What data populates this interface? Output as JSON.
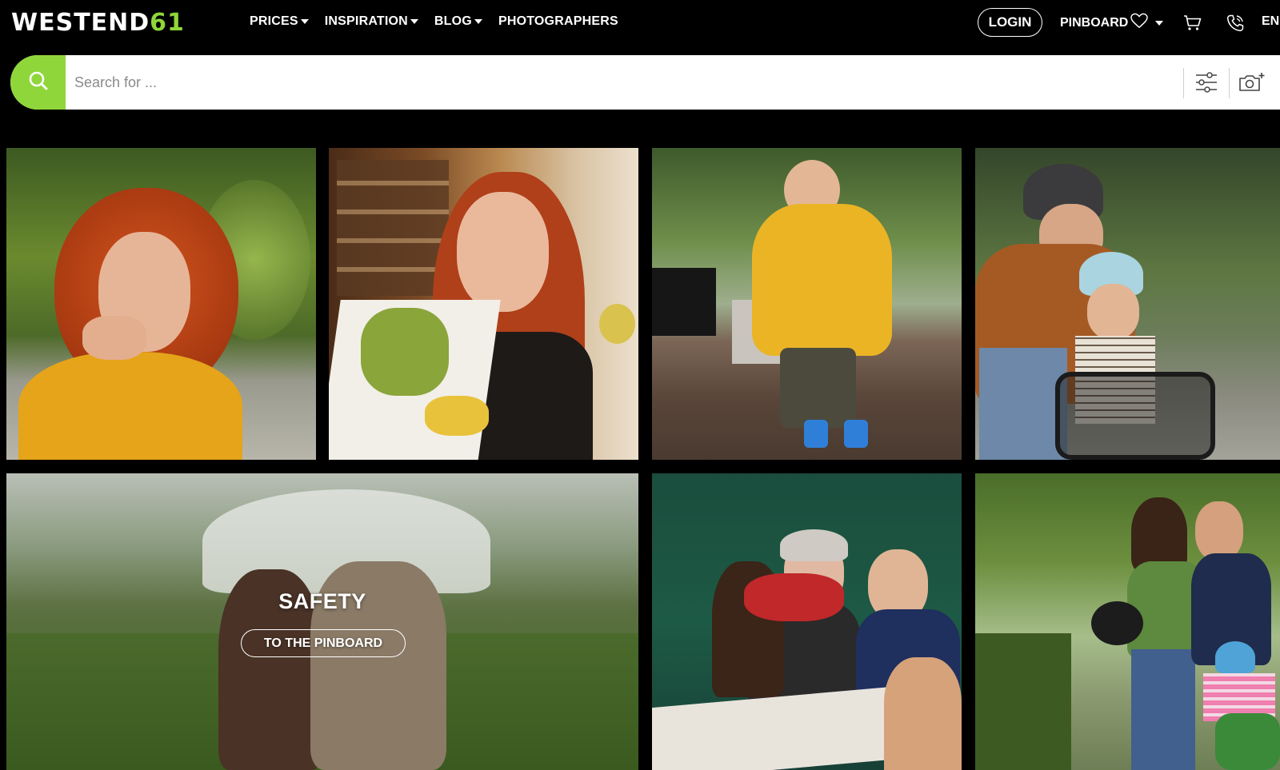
{
  "header": {
    "logo_main": "WESTEND",
    "logo_accent": "61",
    "nav": [
      {
        "label": "PRICES",
        "dropdown": true
      },
      {
        "label": "INSPIRATION",
        "dropdown": true
      },
      {
        "label": "BLOG",
        "dropdown": true
      },
      {
        "label": "PHOTOGRAPHERS",
        "dropdown": false
      }
    ],
    "login_label": "LOGIN",
    "pinboard_label": "PINBOARD",
    "language": "EN",
    "icons": [
      "heart-icon",
      "cart-icon",
      "phone-icon"
    ]
  },
  "search": {
    "placeholder": "Search for ...",
    "value": "",
    "icons": [
      "search-icon",
      "filter-icon",
      "camera-search-icon"
    ]
  },
  "feature": {
    "title": "SAFETY",
    "button_label": "TO THE PINBOARD"
  },
  "colors": {
    "accent": "#8fd63a",
    "background": "#000000"
  }
}
